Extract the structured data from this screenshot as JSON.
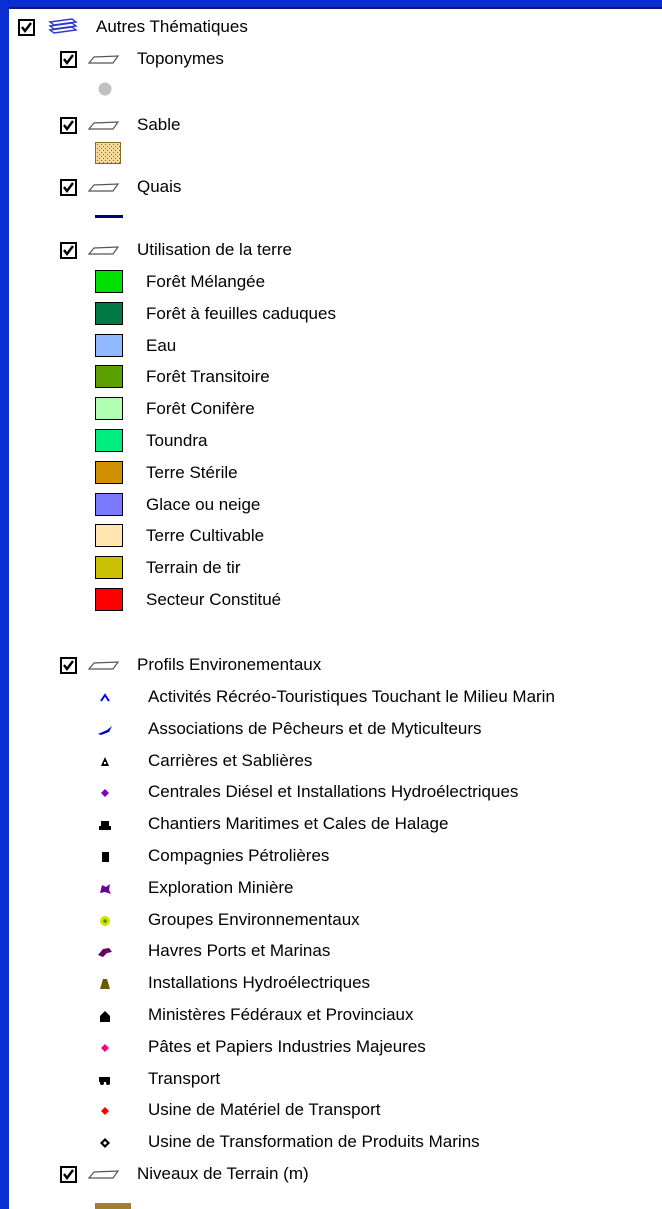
{
  "tree": {
    "root": {
      "label": "Autres Thématiques",
      "checked": true,
      "icon": "layer-group-icon"
    },
    "layers": {
      "toponymes": {
        "label": "Toponymes",
        "checked": true,
        "symbol": "grey-dot"
      },
      "sable": {
        "label": "Sable",
        "checked": true,
        "symbol": "sand-fill",
        "color": "#f5d99a"
      },
      "quais": {
        "label": "Quais",
        "checked": true,
        "symbol": "navy-line",
        "color": "#000080"
      },
      "utilisation": {
        "label": "Utilisation de la terre",
        "checked": true,
        "classes": [
          {
            "label": "Forêt Mélangée",
            "color": "#00e000"
          },
          {
            "label": "Forêt à feuilles caduques",
            "color": "#007a44"
          },
          {
            "label": "Eau",
            "color": "#8fb8ff"
          },
          {
            "label": "Forêt Transitoire",
            "color": "#5aa000"
          },
          {
            "label": "Forêt Conifère",
            "color": "#b0ffb0"
          },
          {
            "label": "Toundra",
            "color": "#00ee80"
          },
          {
            "label": "Terre Stérile",
            "color": "#d09000"
          },
          {
            "label": "Glace ou neige",
            "color": "#7a7aff"
          },
          {
            "label": "Terre Cultivable",
            "color": "#ffe6b0"
          },
          {
            "label": "Terrain de tir",
            "color": "#c8c000"
          },
          {
            "label": "Secteur Constitué",
            "color": "#ff0000"
          }
        ]
      },
      "profils": {
        "label": "Profils Environementaux",
        "checked": true,
        "classes": [
          {
            "label": "Activités Récréo-Touristiques Touchant le Milieu Marin",
            "color": "#0000ff",
            "icon": "caret-up-icon"
          },
          {
            "label": "Associations de Pêcheurs et de Myticulteurs",
            "color": "#0000cc",
            "icon": "fish-icon"
          },
          {
            "label": "Carrières et Sablières",
            "color": "#000000",
            "icon": "pick-icon"
          },
          {
            "label": "Centrales Diésel et Installations Hydroélectriques",
            "color": "#8000c0",
            "icon": "diamond-icon"
          },
          {
            "label": "Chantiers Maritimes et Cales de Halage",
            "color": "#000000",
            "icon": "ship-icon"
          },
          {
            "label": "Compagnies Pétrolières",
            "color": "#000000",
            "icon": "oil-can-icon"
          },
          {
            "label": "Exploration Minière",
            "color": "#660099",
            "icon": "mine-icon"
          },
          {
            "label": "Groupes Environnementaux",
            "color": "#c8e600",
            "icon": "circle-icon"
          },
          {
            "label": "Havres Ports et Marinas",
            "color": "#660066",
            "icon": "harbor-icon"
          },
          {
            "label": "Installations Hydroélectriques",
            "color": "#6a5a00",
            "icon": "dam-icon"
          },
          {
            "label": "Ministères Fédéraux et Provinciaux",
            "color": "#000000",
            "icon": "building-icon"
          },
          {
            "label": "Pâtes et Papiers Industries Majeures",
            "color": "#ff0080",
            "icon": "diamond-icon"
          },
          {
            "label": "Transport",
            "color": "#000000",
            "icon": "truck-icon"
          },
          {
            "label": "Usine de Matériel de Transport",
            "color": "#ff0000",
            "icon": "diamond-icon"
          },
          {
            "label": "Usine de Transformation de Produits Marins",
            "color": "#000000",
            "icon": "diamond-outline-icon"
          }
        ]
      },
      "niveaux": {
        "label": "Niveaux de Terrain (m)",
        "checked": true,
        "symbol": "tan-swatch",
        "color": "#a08030"
      }
    }
  },
  "colors": {
    "frame": "#0a2ed0",
    "grey_dot": "#c0c0c0"
  }
}
